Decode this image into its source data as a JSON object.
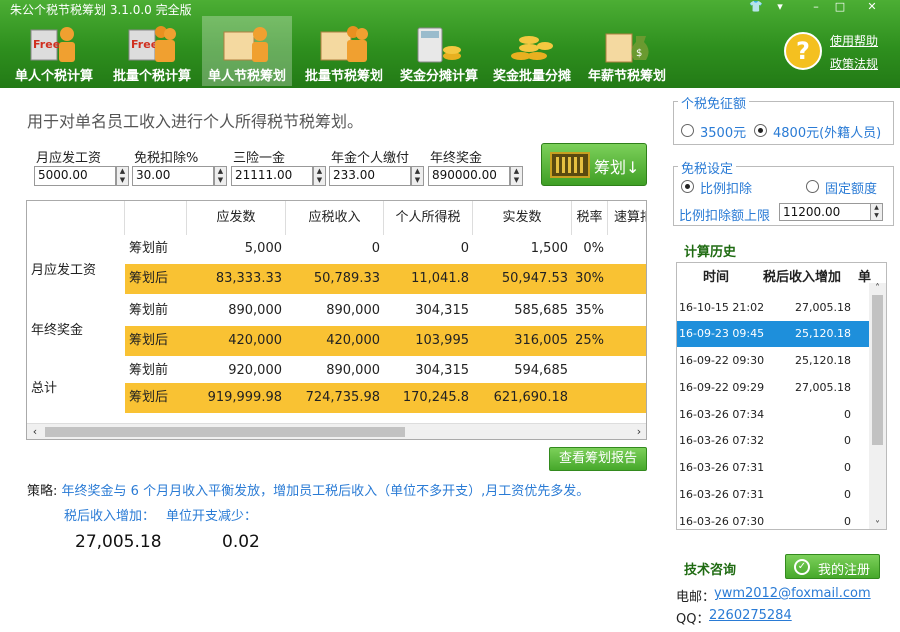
{
  "window": {
    "title": "朱公个税节税筹划 3.1.0.0 完全版",
    "controls": [
      "shirt-icon",
      "menu-icon",
      "minimize-icon",
      "maximize-icon",
      "close-icon"
    ]
  },
  "toolbar": {
    "tools": [
      {
        "label": "单人个税计算",
        "icon": "free-person-icon"
      },
      {
        "label": "批量个税计算",
        "icon": "free-group-icon"
      },
      {
        "label": "单人节税筹划",
        "icon": "person-book-icon"
      },
      {
        "label": "批量节税筹划",
        "icon": "group-book-icon"
      },
      {
        "label": "奖金分摊计算",
        "icon": "calculator-coins-icon"
      },
      {
        "label": "奖金批量分摊",
        "icon": "coins-pile-icon"
      },
      {
        "label": "年薪节税筹划",
        "icon": "money-bag-icon"
      }
    ],
    "active_index": 2,
    "help_link": "使用帮助",
    "policy_link": "政策法规",
    "help_icon": "question-icon"
  },
  "main": {
    "subtitle": "用于对单名员工收入进行个人所得税节税筹划。",
    "fields": [
      {
        "label": "月应发工资",
        "value": "5000.00"
      },
      {
        "label": "免税扣除%",
        "value": "30.00"
      },
      {
        "label": "三险一金",
        "value": "21111.00"
      },
      {
        "label": "年金个人缴付",
        "value": "233.00"
      },
      {
        "label": "年终奖金",
        "value": "890000.00"
      }
    ],
    "plan_button": "筹划↓",
    "table": {
      "headers": [
        "应发数",
        "应税收入",
        "个人所得税",
        "实发数",
        "税率",
        "速算扣"
      ],
      "groups": [
        {
          "name": "月应发工资",
          "rows": [
            {
              "label": "筹划前",
              "cells": [
                "5,000",
                "0",
                "0",
                "1,500",
                "0%"
              ]
            },
            {
              "label": "筹划后",
              "cells": [
                "83,333.33",
                "50,789.33",
                "11,041.8",
                "50,947.53",
                "30%"
              ]
            }
          ]
        },
        {
          "name": "年终奖金",
          "rows": [
            {
              "label": "筹划前",
              "cells": [
                "890,000",
                "890,000",
                "304,315",
                "585,685",
                "35%"
              ]
            },
            {
              "label": "筹划后",
              "cells": [
                "420,000",
                "420,000",
                "103,995",
                "316,005",
                "25%"
              ]
            }
          ]
        },
        {
          "name": "总计",
          "rows": [
            {
              "label": "筹划前",
              "cells": [
                "920,000",
                "890,000",
                "304,315",
                "594,685",
                ""
              ]
            },
            {
              "label": "筹划后",
              "cells": [
                "919,999.98",
                "724,735.98",
                "170,245.8",
                "621,690.18",
                ""
              ]
            }
          ]
        }
      ],
      "highlight_color": "#f9c233"
    },
    "report_button": "查看筹划报告",
    "strategy_label": "策略:",
    "strategy_text": "年终奖金与 6 个月月收入平衡发放，增加员工税后收入（单位不多开支）,月工资优先多发。",
    "after_tax_label": "税后收入增加：",
    "after_tax_value": "27,005.18",
    "expense_label": "单位开支减少：",
    "expense_value": "0.02"
  },
  "right": {
    "exempt_group_title": "个税免征额",
    "exempt_options": [
      "3500元",
      "4800元(外籍人员)"
    ],
    "exempt_selected": 1,
    "setting_group_title": "免税设定",
    "setting_options": [
      "比例扣除",
      "固定额度"
    ],
    "setting_selected": 0,
    "limit_label": "比例扣除额上限",
    "limit_value": "11200.00",
    "history_title": "计算历史",
    "history_headers": [
      "时间",
      "税后收入增加",
      "单"
    ],
    "history": [
      {
        "time": "16-10-15 21:02",
        "value": "27,005.18"
      },
      {
        "time": "16-09-23 09:45",
        "value": "25,120.18"
      },
      {
        "time": "16-09-22 09:30",
        "value": "25,120.18"
      },
      {
        "time": "16-09-22 09:29",
        "value": "27,005.18"
      },
      {
        "time": "16-03-26 07:34",
        "value": "0"
      },
      {
        "time": "16-03-26 07:32",
        "value": "0"
      },
      {
        "time": "16-03-26 07:31",
        "value": "0"
      },
      {
        "time": "16-03-26 07:31",
        "value": "0"
      },
      {
        "time": "16-03-26 07:30",
        "value": "0"
      }
    ],
    "history_selected": 1,
    "tech_title": "技术咨询",
    "register_button": "我的注册",
    "email_label": "电邮：",
    "email": "ywm2012@foxmail.com",
    "qq_label": "QQ：",
    "qq": "2260275284"
  },
  "colors": {
    "accent_green": "#2e8f1e",
    "link_blue": "#2a7bd5",
    "selection": "#1e8fdb"
  }
}
